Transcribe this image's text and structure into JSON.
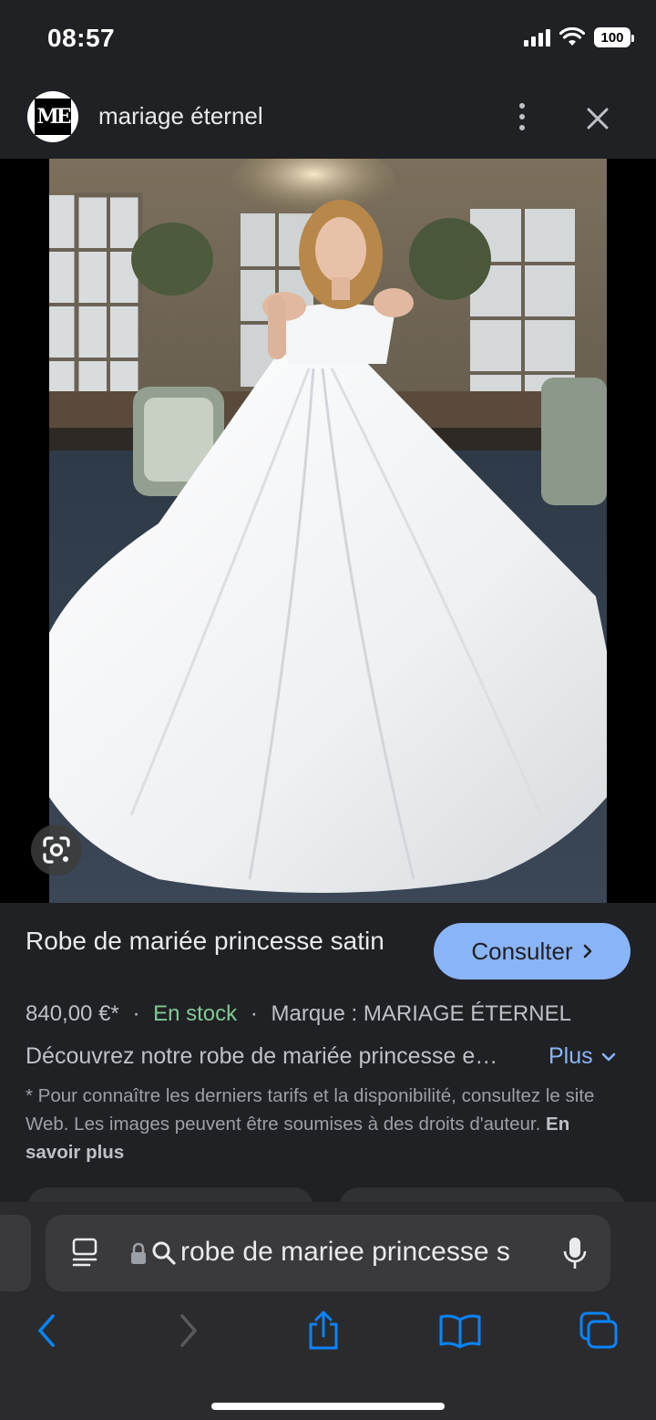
{
  "status_bar": {
    "time": "08:57",
    "battery": "100"
  },
  "header": {
    "logo_text": "ME",
    "site_name": "mariage éternel"
  },
  "product": {
    "title": "Robe de mariée princesse satin",
    "consult_label": "Consulter",
    "price": "840,00 €*",
    "separator": "·",
    "stock": "En stock",
    "brand": "Marque : MARIAGE ÉTERNEL",
    "description": "Découvrez notre robe de mariée princesse e…",
    "more_label": "Plus",
    "note": "* Pour connaître les derniers tarifs et la disponibilité, consultez le site Web. Les images peuvent être soumises à des droits d'auteur.",
    "learn_more": "En savoir plus"
  },
  "browser": {
    "url_text": "robe de mariee princesse s"
  },
  "colors": {
    "background": "#202124",
    "accent": "#8ab4f8",
    "stock_green": "#81c995",
    "ios_blue": "#0a84ff"
  }
}
